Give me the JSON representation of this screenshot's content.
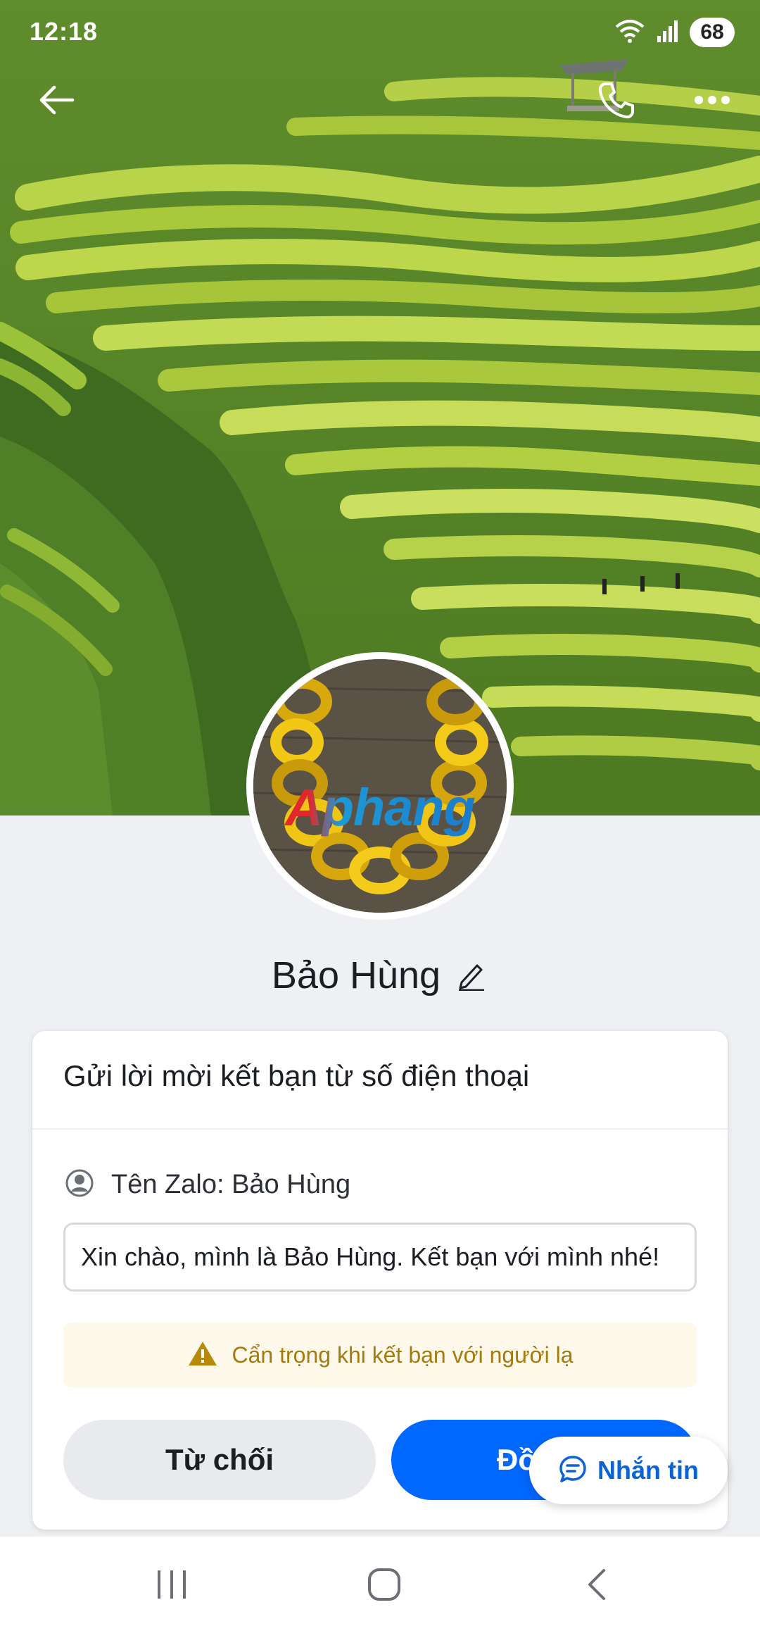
{
  "status_bar": {
    "time": "12:18",
    "battery": "68"
  },
  "profile": {
    "name": "Bảo Hùng",
    "avatar_logo_text": "Aphang"
  },
  "request_card": {
    "title": "Gửi lời mời kết bạn từ số điện thoại",
    "zalo_name_label": "Tên Zalo: Bảo Hùng",
    "message_value": "Xin chào, mình là Bảo Hùng. Kết bạn với mình nhé!",
    "warning_text": "Cẩn trọng khi kết bạn với người lạ",
    "decline_label": "Từ chối",
    "accept_label": "Đồ"
  },
  "chat_fab": {
    "label": "Nhắn tin"
  },
  "colors": {
    "primary": "#0068ff",
    "warning_bg": "#fff9eb",
    "warning_text": "#a57b10",
    "page_bg": "#eef0f4"
  },
  "icons": {
    "back": "arrow-left-icon",
    "call": "phone-icon",
    "more": "more-dots-icon",
    "edit": "pencil-icon",
    "user": "user-circle-icon",
    "warning": "warning-triangle-icon",
    "chat": "chat-bubble-icon"
  }
}
